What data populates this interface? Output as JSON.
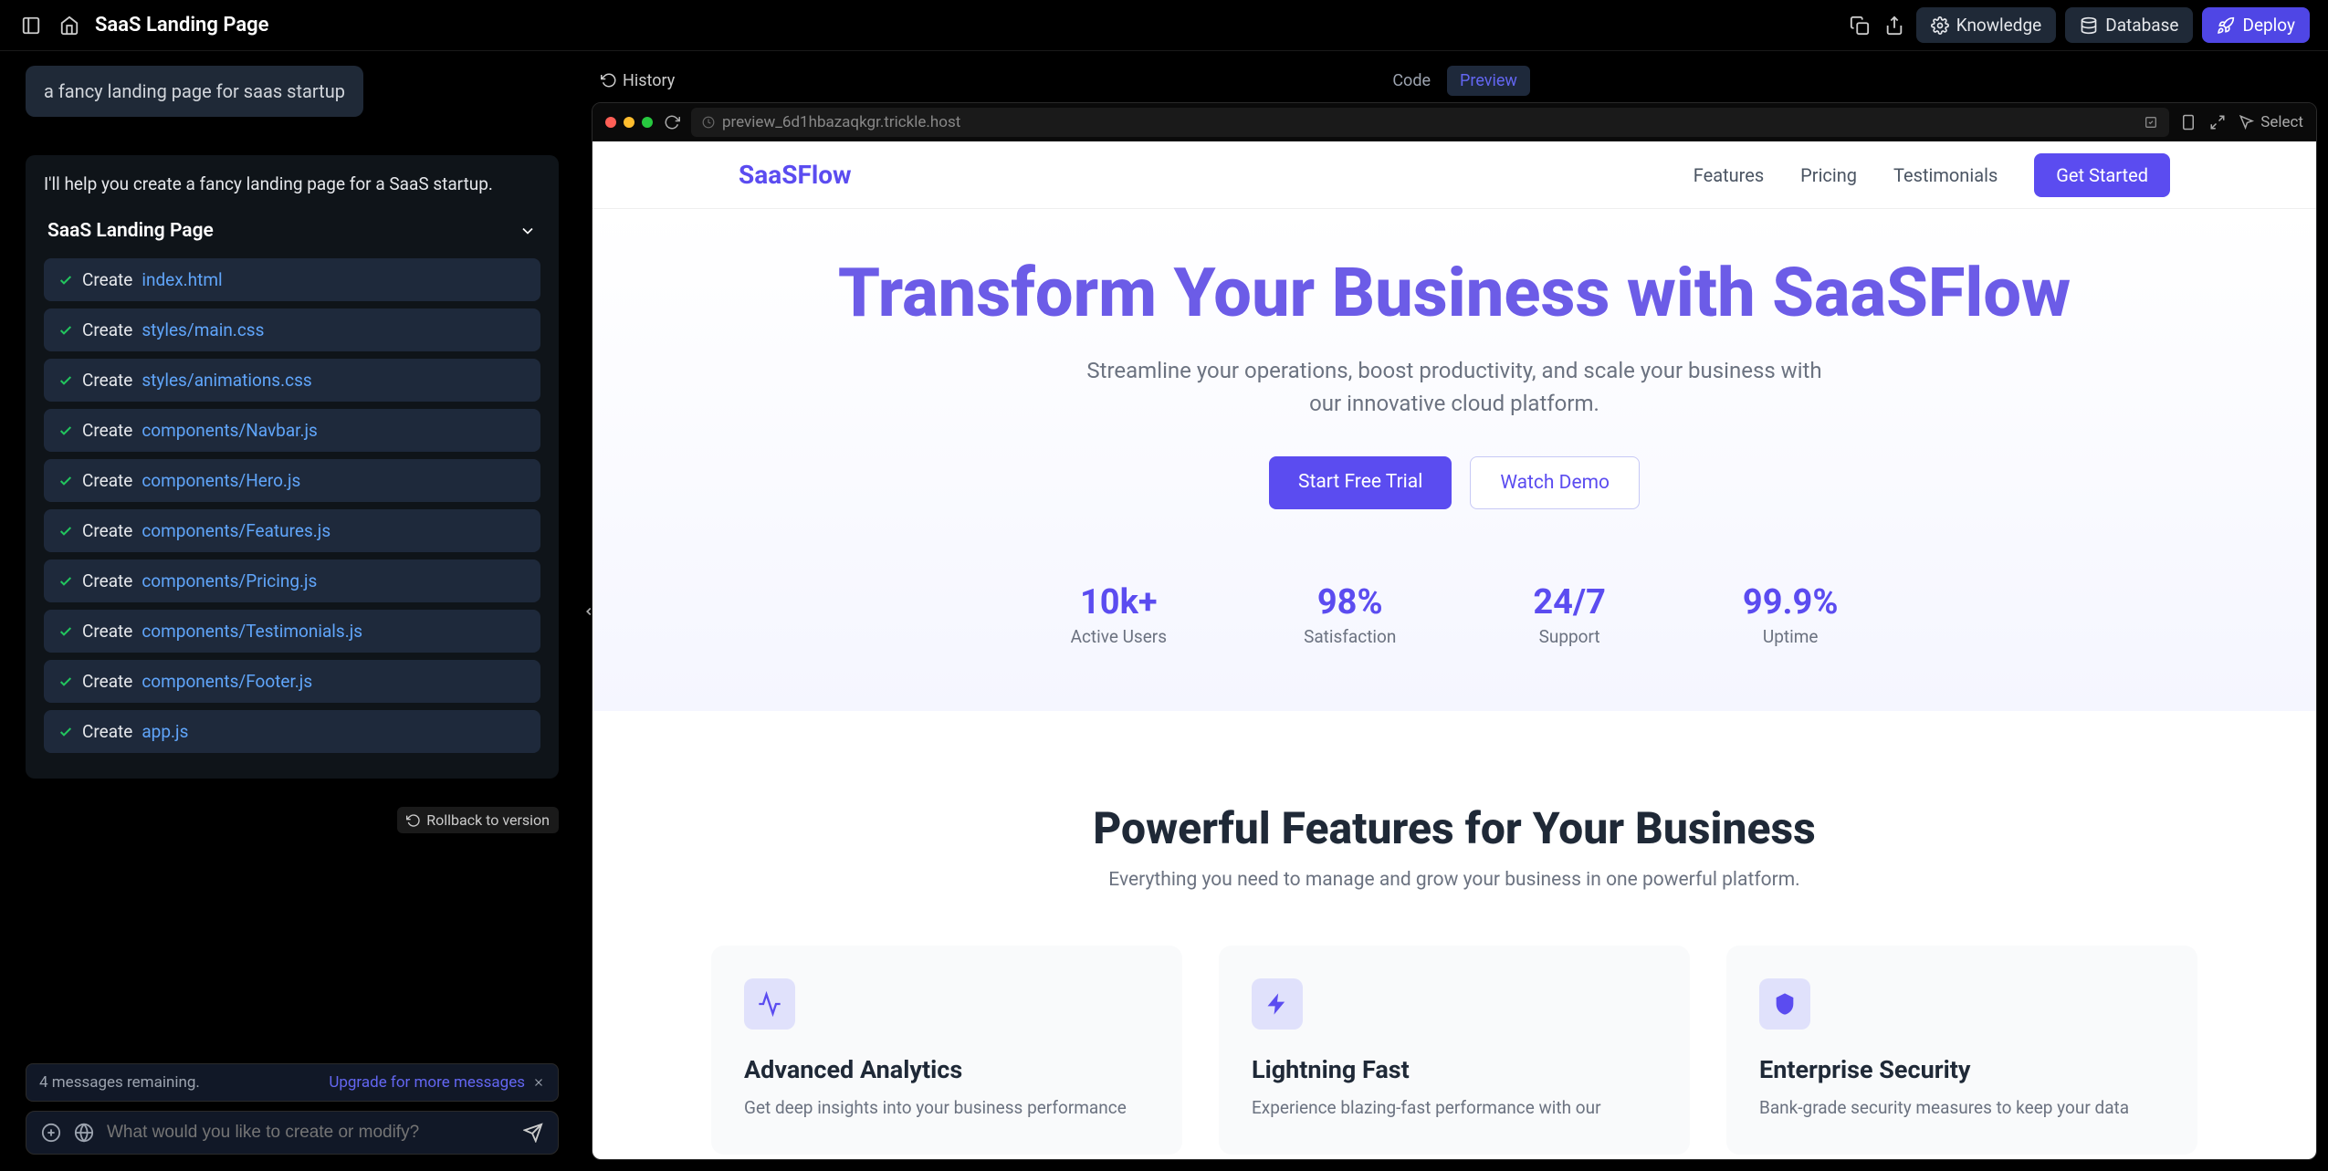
{
  "topbar": {
    "title": "SaaS Landing Page",
    "knowledge": "Knowledge",
    "database": "Database",
    "deploy": "Deploy"
  },
  "chat": {
    "userPrompt": "a fancy landing page for saas startup",
    "assistantIntro": "I'll help you create a fancy landing page for a SaaS startup.",
    "groupTitle": "SaaS Landing Page",
    "tasks": [
      {
        "action": "Create",
        "file": "index.html"
      },
      {
        "action": "Create",
        "file": "styles/main.css"
      },
      {
        "action": "Create",
        "file": "styles/animations.css"
      },
      {
        "action": "Create",
        "file": "components/Navbar.js"
      },
      {
        "action": "Create",
        "file": "components/Hero.js"
      },
      {
        "action": "Create",
        "file": "components/Features.js"
      },
      {
        "action": "Create",
        "file": "components/Pricing.js"
      },
      {
        "action": "Create",
        "file": "components/Testimonials.js"
      },
      {
        "action": "Create",
        "file": "components/Footer.js"
      },
      {
        "action": "Create",
        "file": "app.js"
      }
    ],
    "rollback": "Rollback to version"
  },
  "footer": {
    "remaining": "4 messages remaining.",
    "upgrade": "Upgrade for more messages",
    "placeholder": "What would you like to create or modify?"
  },
  "previewToolbar": {
    "history": "History",
    "code": "Code",
    "preview": "Preview",
    "url": "preview_6d1hbazaqkgr.trickle.host",
    "select": "Select"
  },
  "landing": {
    "logo": "SaaSFlow",
    "nav": {
      "features": "Features",
      "pricing": "Pricing",
      "testimonials": "Testimonials",
      "cta": "Get Started"
    },
    "hero": {
      "titlePrefix": "Transform Your Business with ",
      "titleBrand": "SaaSFlow",
      "subtitle": "Streamline your operations, boost productivity, and scale your business with our innovative cloud platform.",
      "primary": "Start Free Trial",
      "secondary": "Watch Demo"
    },
    "stats": [
      {
        "val": "10k+",
        "lbl": "Active Users"
      },
      {
        "val": "98%",
        "lbl": "Satisfaction"
      },
      {
        "val": "24/7",
        "lbl": "Support"
      },
      {
        "val": "99.9%",
        "lbl": "Uptime"
      }
    ],
    "featuresSection": {
      "title": "Powerful Features for Your Business",
      "subtitle": "Everything you need to manage and grow your business in one powerful platform.",
      "items": [
        {
          "title": "Advanced Analytics",
          "desc": "Get deep insights into your business performance"
        },
        {
          "title": "Lightning Fast",
          "desc": "Experience blazing-fast performance with our"
        },
        {
          "title": "Enterprise Security",
          "desc": "Bank-grade security measures to keep your data"
        }
      ]
    }
  }
}
